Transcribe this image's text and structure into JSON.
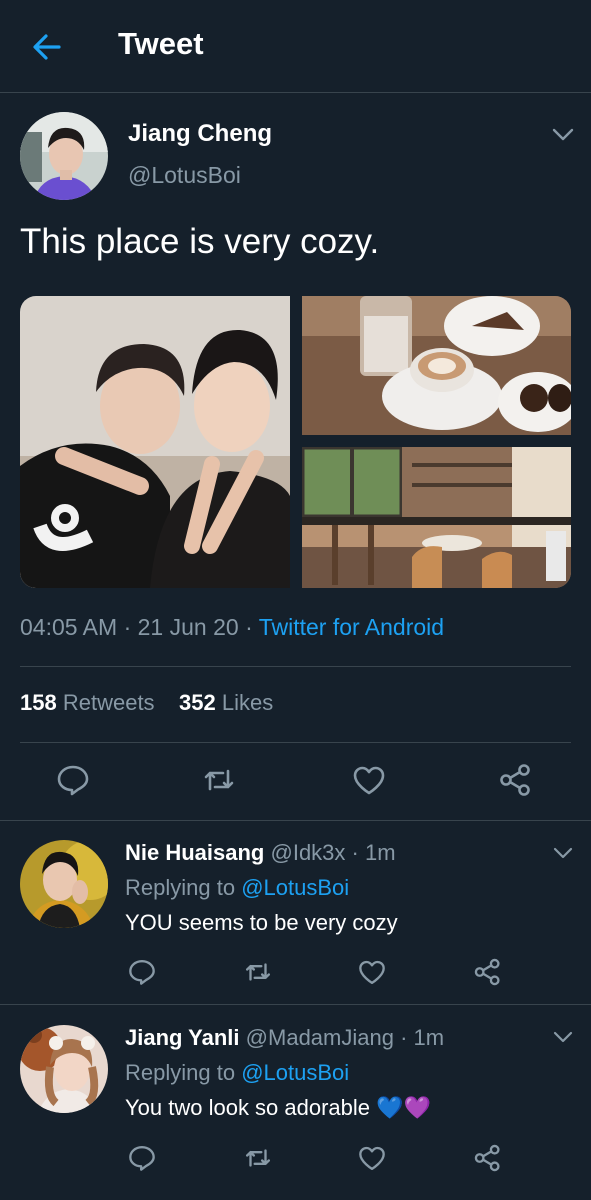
{
  "header": {
    "title": "Tweet",
    "back_icon": "arrow-left-icon"
  },
  "tweet": {
    "author_name": "Jiang Cheng",
    "author_handle": "@LotusBoi",
    "text": "This place is very cozy.",
    "time": "04:05 AM",
    "date": "21 Jun 20",
    "source": "Twitter for Android",
    "sep": "·",
    "retweets_count": "158",
    "retweets_label": "Retweets",
    "likes_count": "352",
    "likes_label": "Likes"
  },
  "replies": [
    {
      "name": "Nie Huaisang",
      "handle": "@Idk3x",
      "time": "· 1m",
      "replying_prefix": "Replying to",
      "replying_to": "@LotusBoi",
      "text": "YOU seems to be very cozy"
    },
    {
      "name": "Jiang Yanli",
      "handle": "@MadamJiang",
      "time": "· 1m",
      "replying_prefix": "Replying to",
      "replying_to": "@LotusBoi",
      "text": "You two look so adorable 💙💜"
    }
  ],
  "colors": {
    "background": "#15202b",
    "accent": "#1da1f2",
    "muted": "#8899a6",
    "divider": "#38444d"
  }
}
